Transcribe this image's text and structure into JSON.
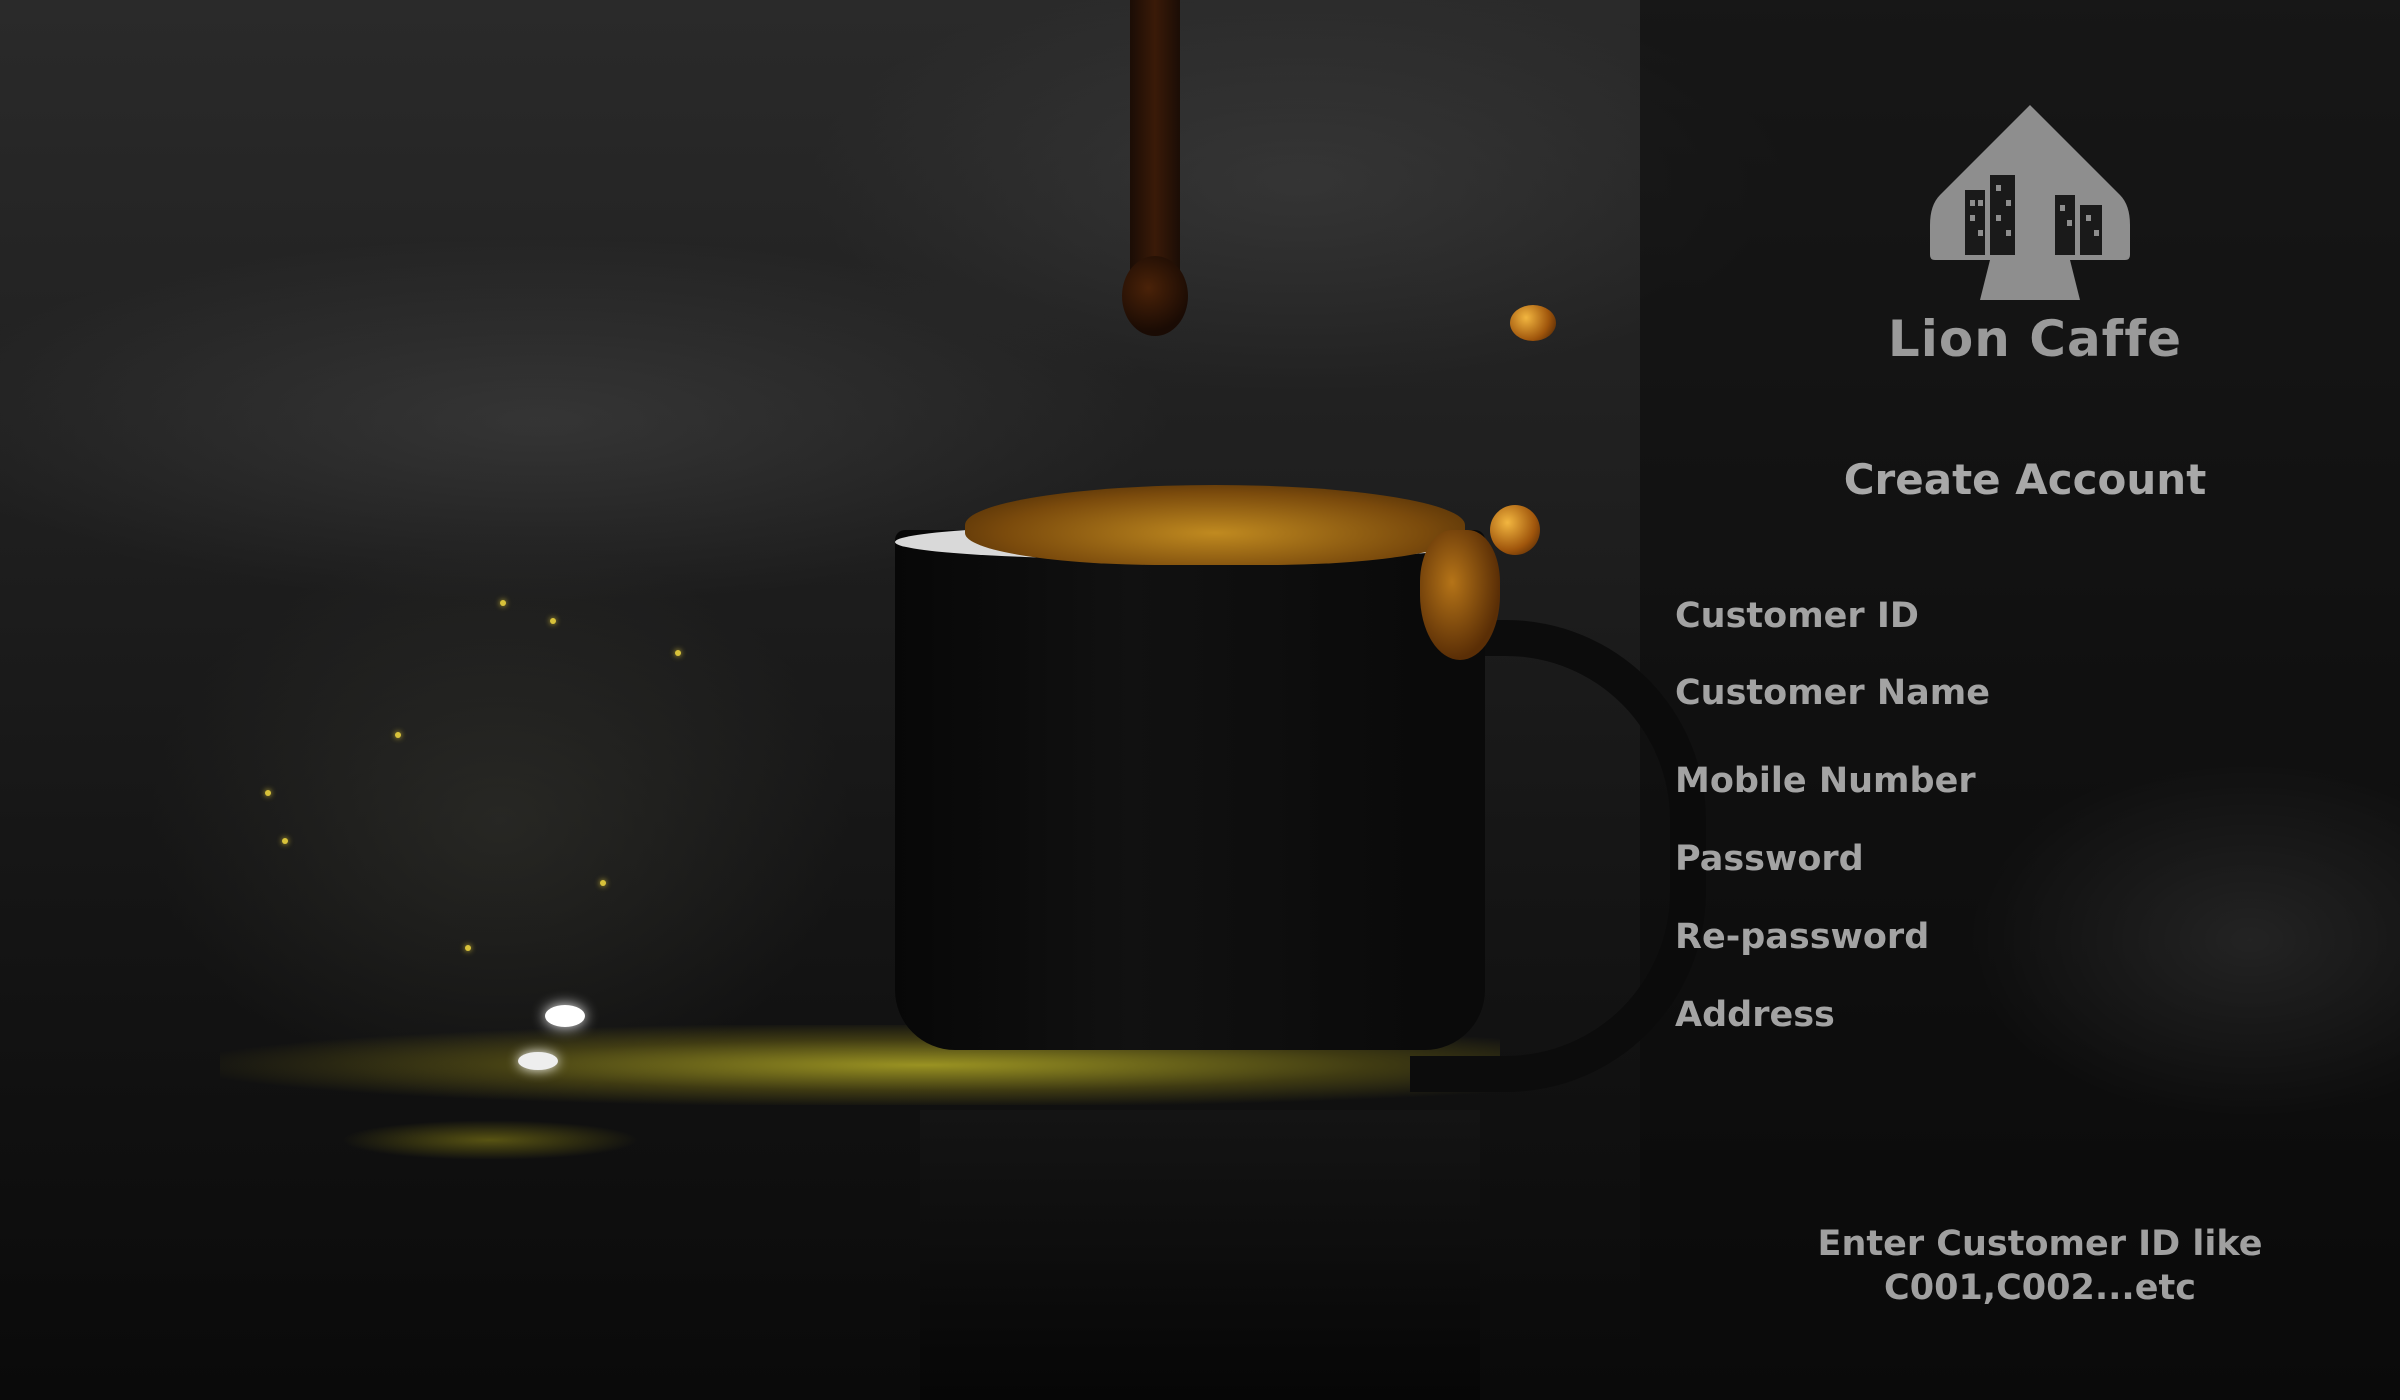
{
  "brand": {
    "name": "Lion Caffe",
    "logo_icon": "lion-caffe-logo-icon"
  },
  "form": {
    "title": "Create Account",
    "fields": [
      {
        "label": "Customer ID",
        "value": ""
      },
      {
        "label": "Customer Name",
        "value": ""
      },
      {
        "label": "Mobile Number",
        "value": ""
      },
      {
        "label": "Password",
        "value": ""
      },
      {
        "label": "Re-password",
        "value": ""
      },
      {
        "label": "Address",
        "value": ""
      }
    ],
    "hint_line1": "Enter Customer ID like",
    "hint_line2": "C001,C002...etc"
  },
  "colors": {
    "panel_overlay": "#0c0c0c",
    "text": "#a3a3a3",
    "coffee_accent": "#c08a20"
  }
}
